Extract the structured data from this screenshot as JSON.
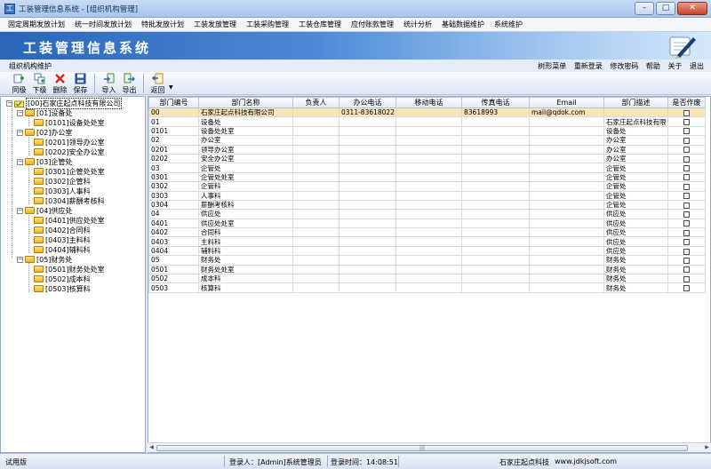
{
  "window": {
    "title": "工装管理信息系统 - [组织机构管理]",
    "app_icon_char": "工"
  },
  "menu": [
    "固定周期发放计划",
    "统一时间发放计划",
    "特批发放计划",
    "工装发放管理",
    "工装采购管理",
    "工装仓库管理",
    "应付账款管理",
    "统计分析",
    "基础数据维护",
    "系统维护"
  ],
  "banner": {
    "title": "工装管理信息系统"
  },
  "page_header": {
    "title": "组织机构维护",
    "links": [
      "树形菜单",
      "重新登录",
      "修改密码",
      "帮助",
      "关于",
      "退出"
    ]
  },
  "toolbar": {
    "same_level": "同级",
    "sub_level": "下级",
    "delete": "删除",
    "save": "保存",
    "import": "导入",
    "export": "导出",
    "back": "返回"
  },
  "tree": {
    "root": "[00]石家庄起点科技有限公司",
    "groups": [
      {
        "label": "[01]设备处",
        "children": [
          "[0101]设备处处室"
        ]
      },
      {
        "label": "[02]办公室",
        "children": [
          "[0201]领导办公室",
          "[0202]安全办公室"
        ]
      },
      {
        "label": "[03]企管处",
        "children": [
          "[0301]企管处处室",
          "[0302]企管科",
          "[0303]人事科",
          "[0304]薪酬考核科"
        ]
      },
      {
        "label": "[04]供应处",
        "children": [
          "[0401]供应处处室",
          "[0402]合同科",
          "[0403]主料科",
          "[0404]辅料科"
        ]
      },
      {
        "label": "[05]财务处",
        "children": [
          "[0501]财务处处室",
          "[0502]成本科",
          "[0503]核算科"
        ]
      }
    ]
  },
  "table": {
    "columns": [
      "部门编号",
      "部门名称",
      "负责人",
      "办公电话",
      "移动电话",
      "传真电话",
      "Email",
      "部门描述",
      "是否作废"
    ],
    "rows": [
      [
        "00",
        "石家庄起点科技有限公司",
        "",
        "0311-83618022",
        "",
        "83618993",
        "mail@qdok.com",
        ""
      ],
      [
        "01",
        "设备处",
        "",
        "",
        "",
        "",
        "",
        "石家庄起点科技有限"
      ],
      [
        "0101",
        "设备处处室",
        "",
        "",
        "",
        "",
        "",
        "设备处"
      ],
      [
        "02",
        "办公室",
        "",
        "",
        "",
        "",
        "",
        "办公室"
      ],
      [
        "0201",
        "领导办公室",
        "",
        "",
        "",
        "",
        "",
        "办公室"
      ],
      [
        "0202",
        "安全办公室",
        "",
        "",
        "",
        "",
        "",
        "办公室"
      ],
      [
        "03",
        "企管处",
        "",
        "",
        "",
        "",
        "",
        "企管处"
      ],
      [
        "0301",
        "企管处处室",
        "",
        "",
        "",
        "",
        "",
        "企管处"
      ],
      [
        "0302",
        "企管科",
        "",
        "",
        "",
        "",
        "",
        "企管处"
      ],
      [
        "0303",
        "人事科",
        "",
        "",
        "",
        "",
        "",
        "企管处"
      ],
      [
        "0304",
        "薪酬考核科",
        "",
        "",
        "",
        "",
        "",
        "企管处"
      ],
      [
        "04",
        "供应处",
        "",
        "",
        "",
        "",
        "",
        "供应处"
      ],
      [
        "0401",
        "供应处处室",
        "",
        "",
        "",
        "",
        "",
        "供应处"
      ],
      [
        "0402",
        "合同科",
        "",
        "",
        "",
        "",
        "",
        "供应处"
      ],
      [
        "0403",
        "主料科",
        "",
        "",
        "",
        "",
        "",
        "供应处"
      ],
      [
        "0404",
        "辅料科",
        "",
        "",
        "",
        "",
        "",
        "供应处"
      ],
      [
        "05",
        "财务处",
        "",
        "",
        "",
        "",
        "",
        "财务处"
      ],
      [
        "0501",
        "财务处处室",
        "",
        "",
        "",
        "",
        "",
        "财务处"
      ],
      [
        "0502",
        "成本科",
        "",
        "",
        "",
        "",
        "",
        "财务处"
      ],
      [
        "0503",
        "核算科",
        "",
        "",
        "",
        "",
        "",
        "财务处"
      ]
    ]
  },
  "status": {
    "mode": "试用版",
    "user": "登录人：[Admin]系统管理员",
    "login_time": "登录时间：14:08:51",
    "company": "石家庄起点科技",
    "website": "www.jdkjsoft.com"
  },
  "colors": {
    "banner": "#2a65b8",
    "selected_row": "#f7e4b8",
    "tree_folder": "#e7b32f"
  },
  "icons": {
    "same_level": "add-sibling-icon",
    "sub_level": "add-child-icon",
    "delete": "delete-x-icon",
    "save": "save-disk-icon",
    "import": "import-icon",
    "export": "export-icon",
    "back": "back-arrow-icon"
  }
}
